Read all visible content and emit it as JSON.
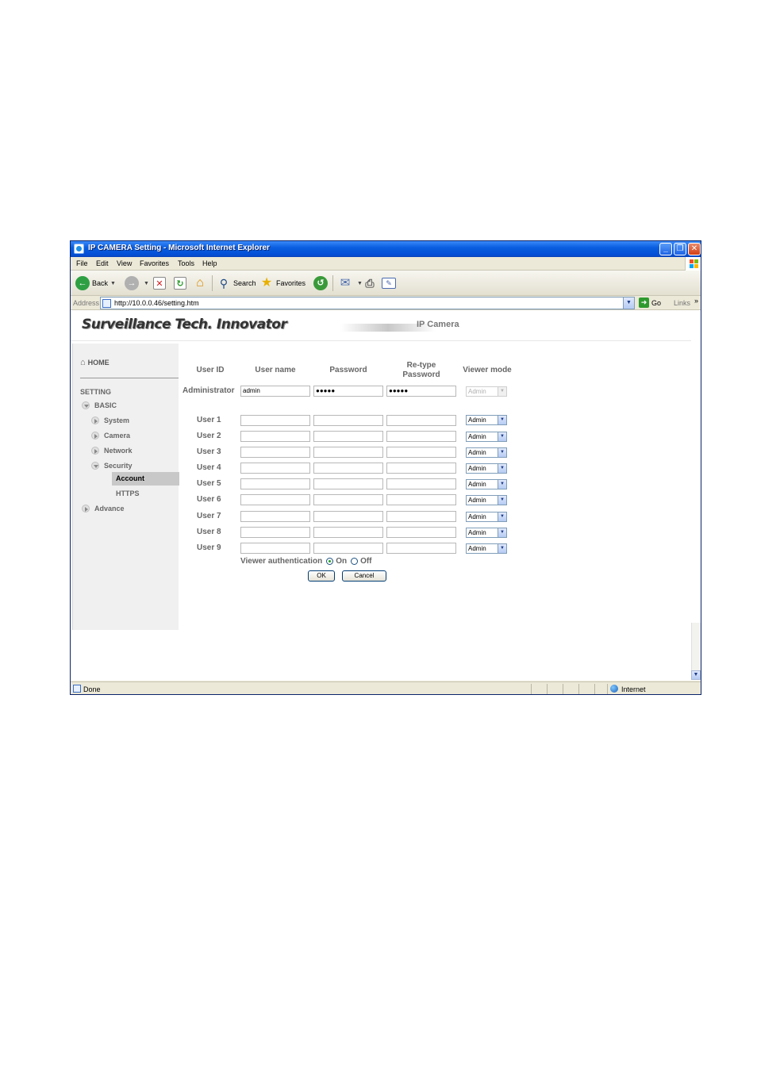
{
  "window": {
    "title": "IP CAMERA Setting - Microsoft Internet Explorer",
    "minimize_glyph": "_",
    "maximize_glyph": "❐",
    "close_glyph": "✕"
  },
  "menu": [
    "File",
    "Edit",
    "View",
    "Favorites",
    "Tools",
    "Help"
  ],
  "toolbar": {
    "back_label": "Back",
    "search_label": "Search",
    "favorites_label": "Favorites"
  },
  "address": {
    "label": "Address",
    "url": "http://10.0.0.46/setting.htm",
    "go_label": "Go",
    "links_label": "Links",
    "links_chevron": "»"
  },
  "banner": {
    "brand": "Surveillance Tech. Innovator",
    "product": "IP Camera"
  },
  "sidebar": {
    "home": "HOME",
    "setting": "SETTING",
    "basic": "BASIC",
    "system": "System",
    "camera": "Camera",
    "network": "Network",
    "security": "Security",
    "account": "Account",
    "https": "HTTPS",
    "advance": "Advance"
  },
  "account_table": {
    "headers": {
      "user_id": "User ID",
      "user_name": "User name",
      "password": "Password",
      "retype_line1": "Re-type",
      "retype_line2": "Password",
      "viewer_mode": "Viewer mode"
    },
    "admin": {
      "label": "Administrator",
      "user_name": "admin",
      "password": "●●●●●",
      "retype": "●●●●●",
      "mode": "Admin"
    },
    "users": [
      {
        "label": "User 1",
        "mode": "Admin"
      },
      {
        "label": "User 2",
        "mode": "Admin"
      },
      {
        "label": "User 3",
        "mode": "Admin"
      },
      {
        "label": "User 4",
        "mode": "Admin"
      },
      {
        "label": "User 5",
        "mode": "Admin"
      },
      {
        "label": "User 6",
        "mode": "Admin"
      },
      {
        "label": "User 7",
        "mode": "Admin"
      },
      {
        "label": "User 8",
        "mode": "Admin"
      },
      {
        "label": "User 9",
        "mode": "Admin"
      }
    ],
    "viewer_auth": {
      "label": "Viewer authentication",
      "on_label": "On",
      "off_label": "Off",
      "selected": "On"
    },
    "ok_label": "OK",
    "cancel_label": "Cancel"
  },
  "status": {
    "text": "Done",
    "zone": "Internet"
  },
  "colors": {
    "titlebar": "#0450d6",
    "chrome": "#ece9d8",
    "sidebar": "#f0f0f0",
    "selected_item": "#c8c8c8"
  }
}
